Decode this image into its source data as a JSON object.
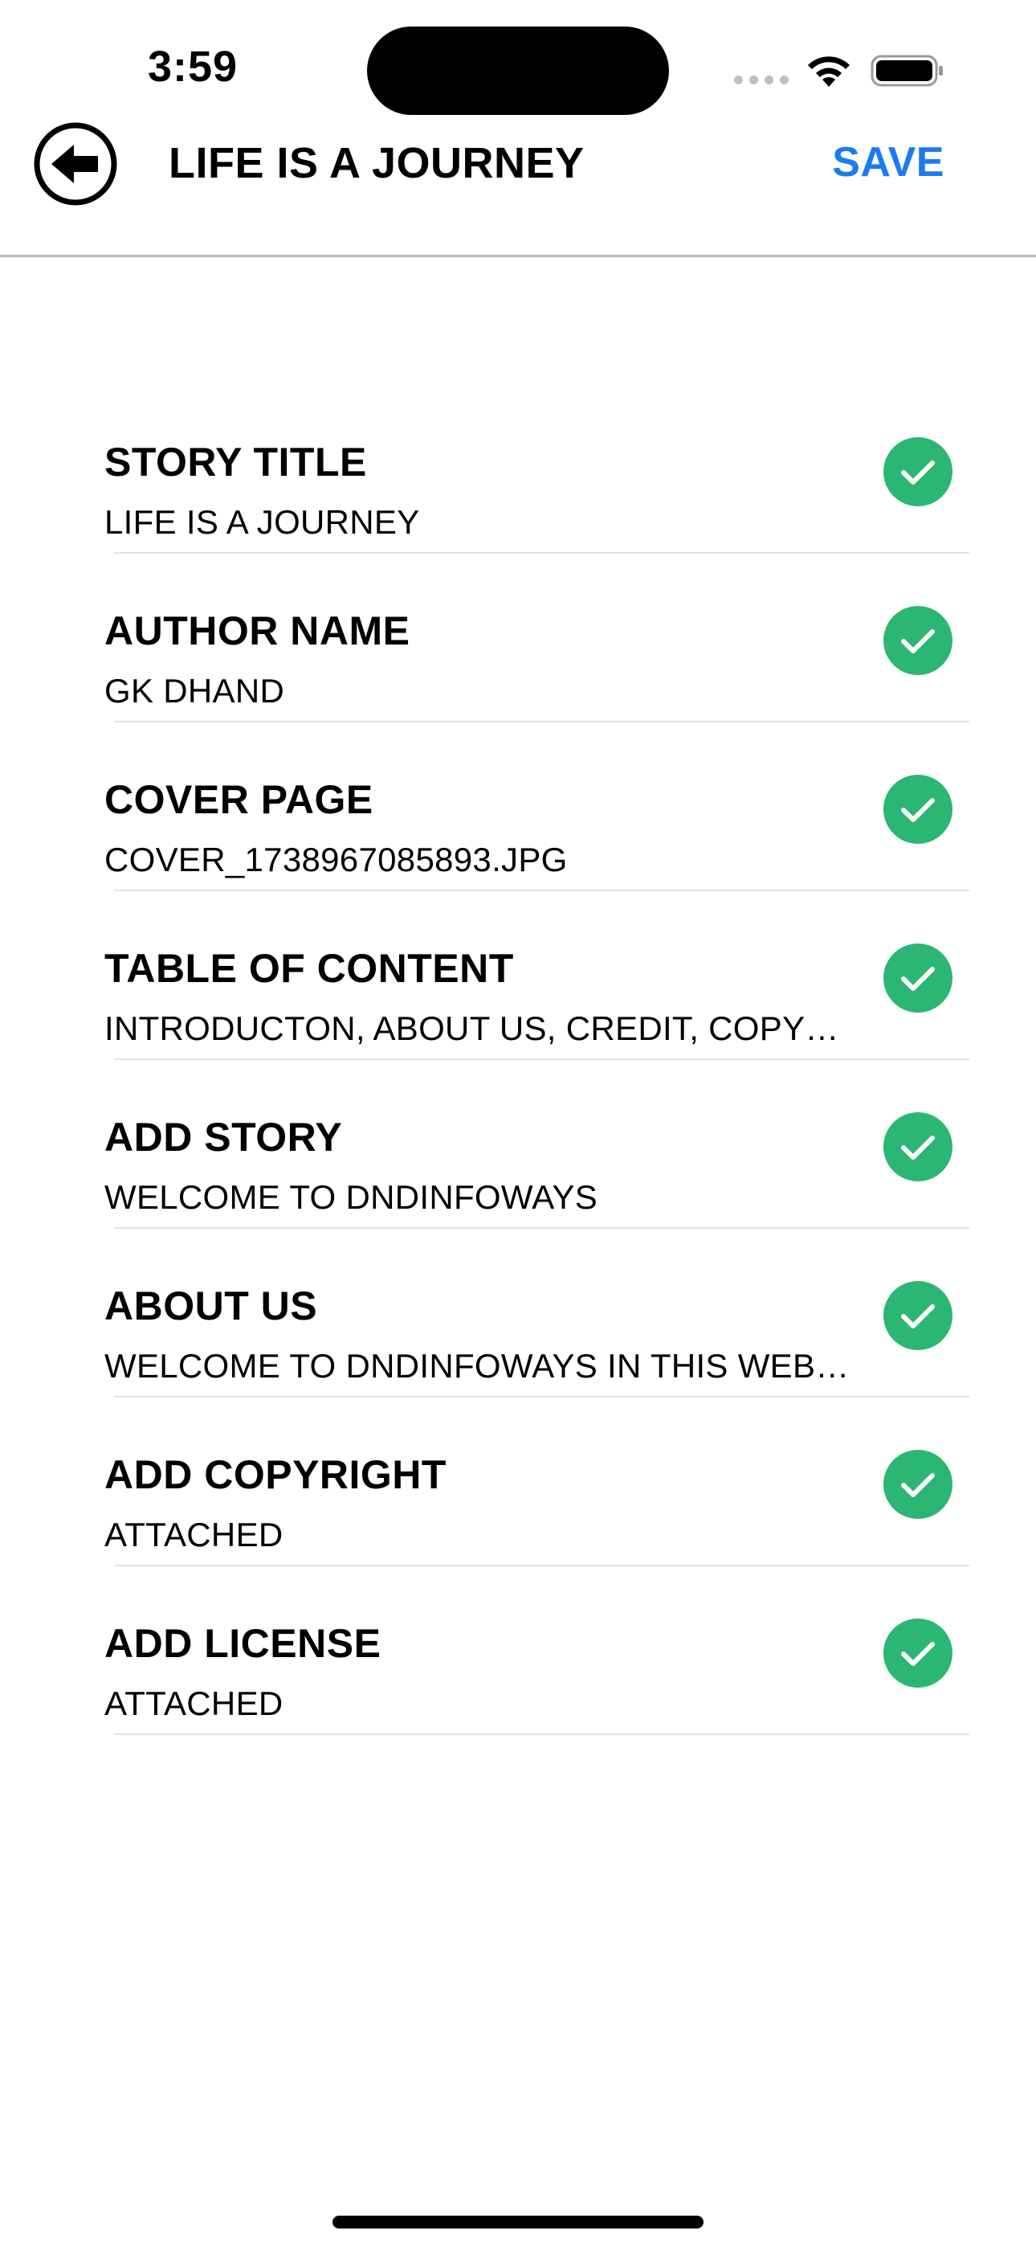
{
  "status_bar": {
    "time": "3:59",
    "icons": [
      "signal-dots-icon",
      "wifi-icon",
      "battery-icon"
    ]
  },
  "header": {
    "back_icon": "back-arrow-circle-icon",
    "title": "LIFE IS A JOURNEY",
    "save_label": "SAVE"
  },
  "colors": {
    "accent": "#1a7cf0",
    "check": "#2bb673",
    "divider": "#e2e2e2"
  },
  "items": [
    {
      "title": "STORY TITLE",
      "value": "LIFE IS A JOURNEY",
      "completed": true
    },
    {
      "title": "AUTHOR NAME",
      "value": "GK DHAND",
      "completed": true
    },
    {
      "title": "COVER PAGE",
      "value": "COVER_1738967085893.JPG",
      "completed": true
    },
    {
      "title": "TABLE OF CONTENT",
      "value": "INTRODUCTON, ABOUT US, CREDIT, COPY…",
      "completed": true
    },
    {
      "title": "ADD STORY",
      "value": "WELCOME TO DNDINFOWAYS",
      "completed": true
    },
    {
      "title": "ABOUT US",
      "value": "WELCOME TO DNDINFOWAYS IN THIS WEBS…",
      "completed": true
    },
    {
      "title": "ADD COPYRIGHT",
      "value": "ATTACHED",
      "completed": true
    },
    {
      "title": "ADD LICENSE",
      "value": "ATTACHED",
      "completed": true
    }
  ]
}
